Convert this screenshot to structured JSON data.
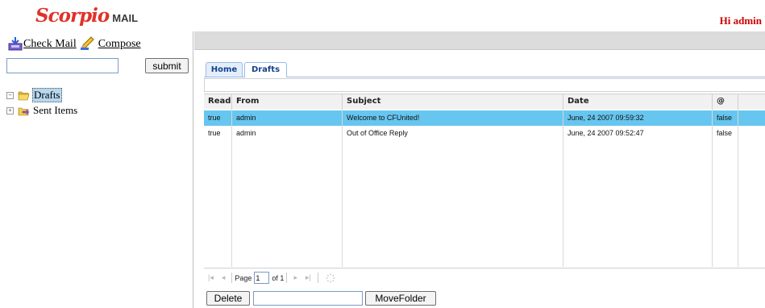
{
  "header": {
    "logo_brand": "Scorpio",
    "logo_suffix": "MAIL",
    "greeting": "Hi admin"
  },
  "sidebar": {
    "check_mail_label": "Check Mail",
    "compose_label": "Compose",
    "search_value": "",
    "submit_label": "submit",
    "folders": [
      {
        "label": "Drafts",
        "selected": true,
        "icon": "open-folder-icon"
      },
      {
        "label": "Sent Items",
        "selected": false,
        "icon": "sent-folder-icon"
      }
    ]
  },
  "tabs": [
    {
      "label": "Home",
      "active": false
    },
    {
      "label": "Drafts",
      "active": true
    }
  ],
  "grid": {
    "columns": [
      "Read",
      "From",
      "Subject",
      "Date",
      "@"
    ],
    "rows": [
      {
        "read": "true",
        "from": "admin",
        "subject": "Welcome to CFUnited!",
        "date": "June, 24 2007 09:59:32",
        "attach": "false",
        "selected": true
      },
      {
        "read": "true",
        "from": "admin",
        "subject": "Out of Office Reply",
        "date": "June, 24 2007 09:52:47",
        "attach": "false",
        "selected": false
      }
    ]
  },
  "paging": {
    "page_label": "Page",
    "page_value": "1",
    "of_label": "of 1"
  },
  "actions": {
    "delete_label": "Delete",
    "folder_value": "",
    "move_label": "MoveFolder"
  },
  "colors": {
    "brand": "#e0322a",
    "greeting": "#cc0000",
    "selected_row": "#67c6ef",
    "tab_text": "#15428b"
  }
}
